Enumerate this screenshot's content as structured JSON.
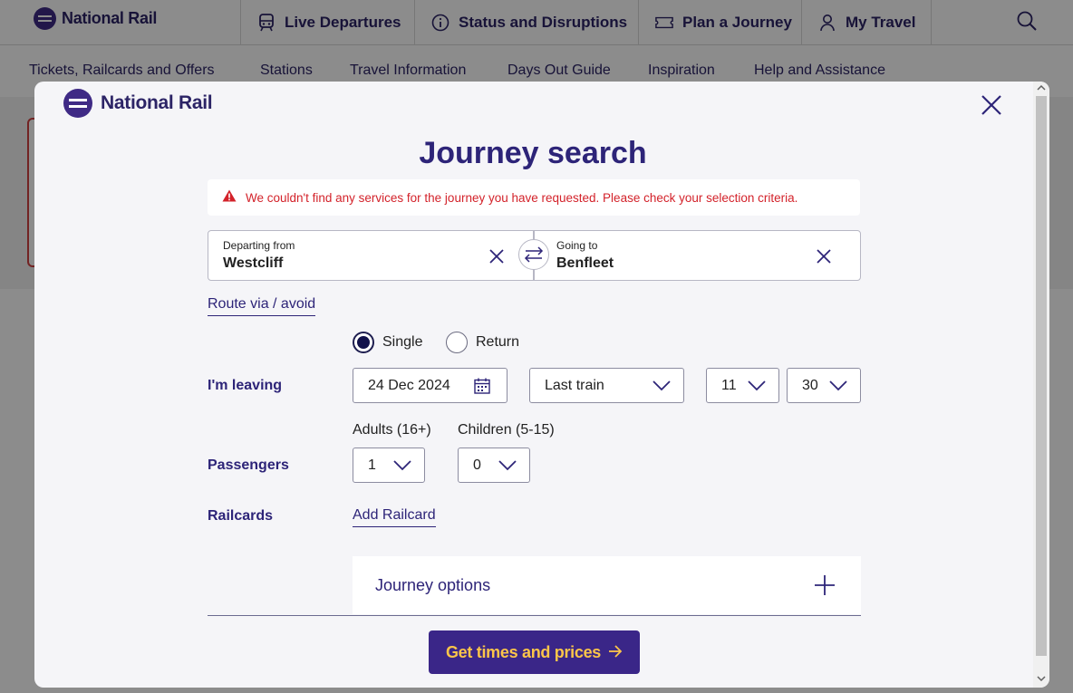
{
  "header": {
    "brand": "National Rail",
    "nav": [
      {
        "label": "Live Departures",
        "icon": "train-icon"
      },
      {
        "label": "Status and Disruptions",
        "icon": "info-icon"
      },
      {
        "label": "Plan a Journey",
        "icon": "ticket-icon"
      },
      {
        "label": "My Travel",
        "icon": "user-icon"
      }
    ],
    "search_icon": "search-icon"
  },
  "subnav": [
    "Tickets, Railcards and Offers",
    "Stations",
    "Travel Information",
    "Days Out Guide",
    "Inspiration",
    "Help and Assistance"
  ],
  "modal": {
    "brand": "National Rail",
    "title": "Journey search",
    "error": "We couldn't find any services for the journey you have requested. Please check your selection criteria.",
    "from": {
      "label": "Departing from",
      "value": "Westcliff"
    },
    "to": {
      "label": "Going to",
      "value": "Benfleet"
    },
    "route_link": "Route via / avoid",
    "ticket_type": {
      "options": [
        "Single",
        "Return"
      ],
      "selected": "Single"
    },
    "leaving": {
      "label": "I'm leaving",
      "date": "24 Dec 2024",
      "time_type": "Last train",
      "hour": "11",
      "minute": "30"
    },
    "passengers": {
      "label": "Passengers",
      "adults_label": "Adults (16+)",
      "adults": "1",
      "children_label": "Children (5-15)",
      "children": "0"
    },
    "railcards": {
      "label": "Railcards",
      "add_label": "Add Railcard"
    },
    "journey_options": "Journey options",
    "submit": "Get times and prices"
  },
  "colors": {
    "brand": "#2d2478",
    "accent_button": "#3a2688",
    "button_text": "#fcc549",
    "error": "#d3222a"
  }
}
